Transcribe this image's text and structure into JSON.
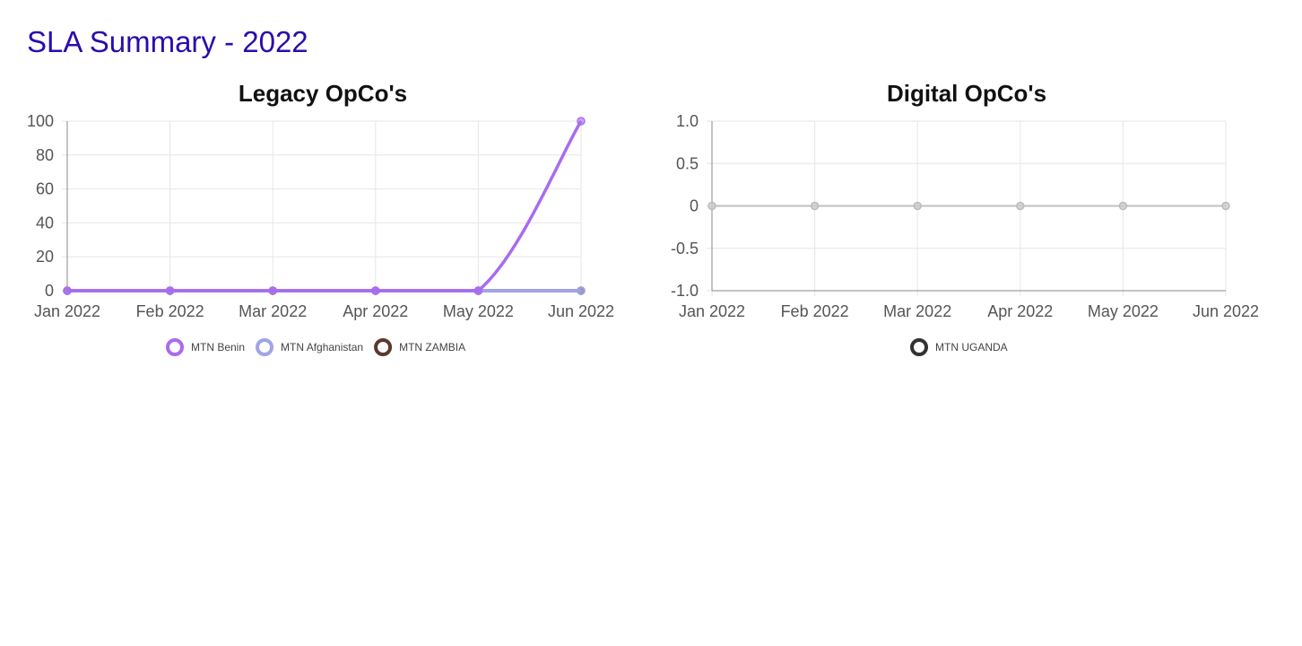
{
  "page": {
    "title": "SLA Summary - 2022"
  },
  "colors": {
    "title": "#2a0cad",
    "grid": "#e6e6e6",
    "axis": "#888888"
  },
  "chart_data": [
    {
      "type": "line",
      "title": "Legacy OpCo's",
      "categories": [
        "Jan 2022",
        "Feb 2022",
        "Mar 2022",
        "Apr 2022",
        "May 2022",
        "Jun 2022"
      ],
      "ylim": [
        0,
        100
      ],
      "yticks": [
        100,
        80,
        60,
        40,
        20,
        0
      ],
      "ytick_labels": [
        "100",
        "80",
        "60",
        "40",
        "20",
        "0"
      ],
      "grid": true,
      "legend_position": "bottom",
      "series": [
        {
          "name": "MTN Benin",
          "values": [
            0,
            0,
            0,
            0,
            0,
            100
          ],
          "color": "#a86bf0"
        },
        {
          "name": "MTN Afghanistan",
          "values": [
            0,
            0,
            0,
            0,
            0,
            0
          ],
          "color": "#a0a4e8"
        },
        {
          "name": "MTN ZAMBIA",
          "values": [
            0,
            0,
            0,
            0,
            0,
            0
          ],
          "color": "#5a3a2e"
        }
      ]
    },
    {
      "type": "line",
      "title": "Digital OpCo's",
      "categories": [
        "Jan 2022",
        "Feb 2022",
        "Mar 2022",
        "Apr 2022",
        "May 2022",
        "Jun 2022"
      ],
      "ylim": [
        -1.0,
        1.0
      ],
      "yticks": [
        1.0,
        0.5,
        0,
        -0.5,
        -1.0
      ],
      "ytick_labels": [
        "1.0",
        "0.5",
        "0",
        "-0.5",
        "-1.0"
      ],
      "grid": true,
      "legend_position": "bottom",
      "series": [
        {
          "name": "MTN UGANDA",
          "values": [
            0,
            0,
            0,
            0,
            0,
            0
          ],
          "color": "#333333"
        }
      ]
    }
  ]
}
